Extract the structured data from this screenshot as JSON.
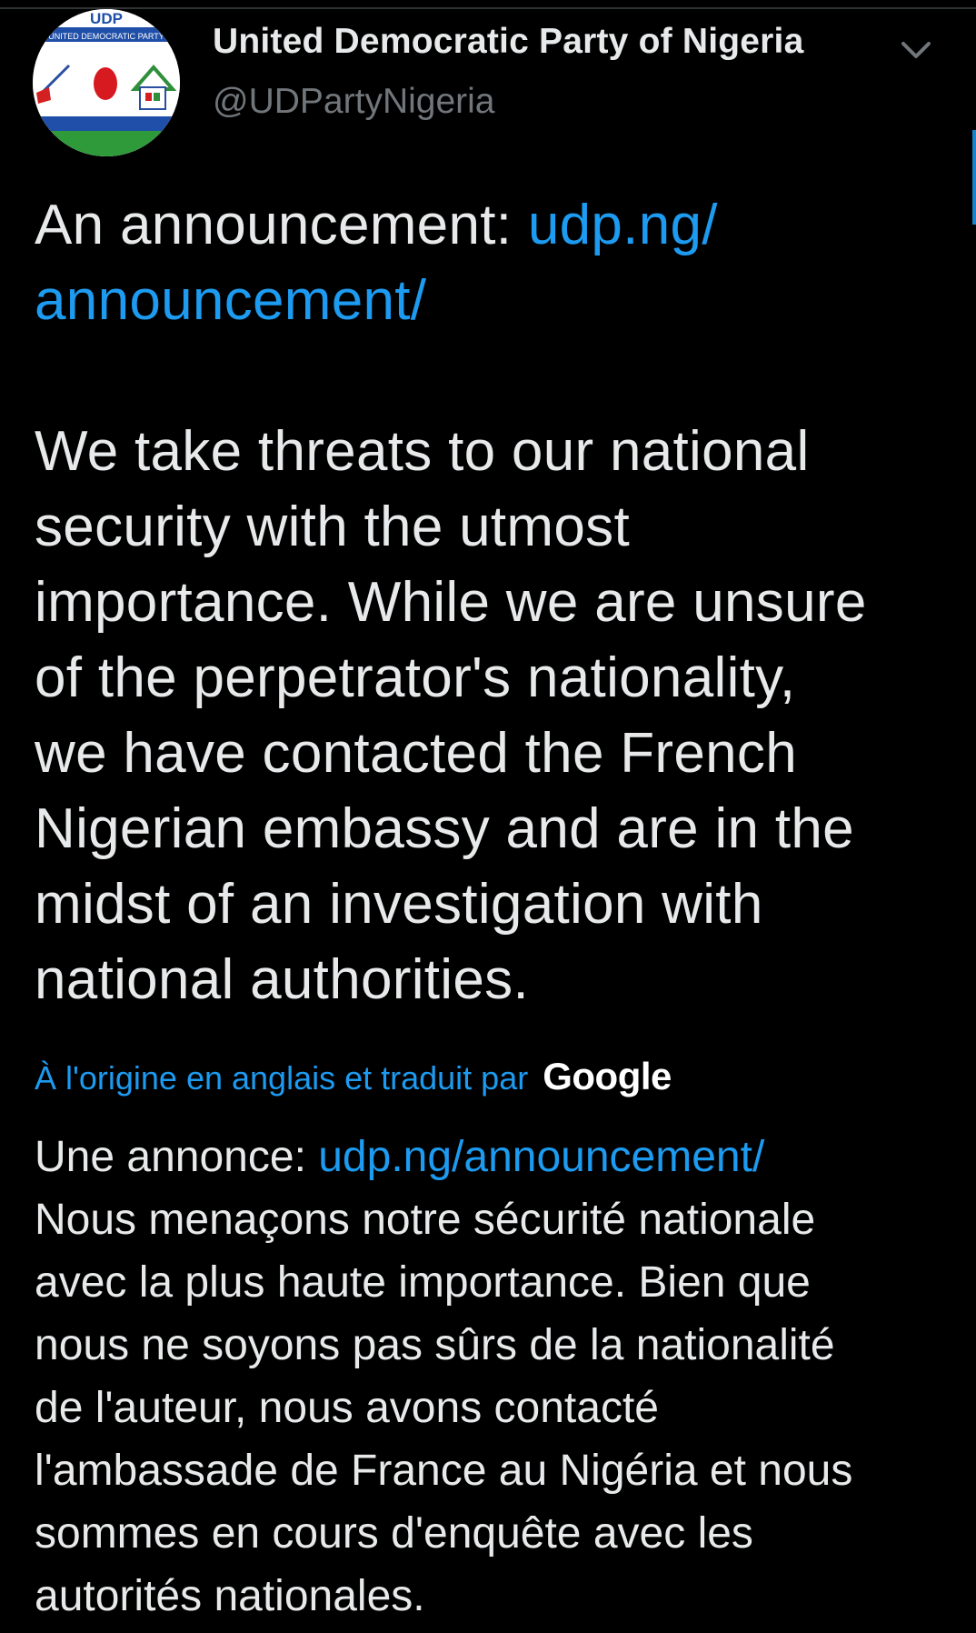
{
  "tweet": {
    "author": {
      "display_name": "United Democratic Party of Nigeria",
      "handle": "@UDPartyNigeria",
      "avatar_text_top": "UDP",
      "avatar_text_sub": "UNITED DEMOCRATIC PARTY"
    },
    "menu_icon": "chevron-down-icon",
    "body": {
      "intro_prefix": "An announcement: ",
      "link_part1": "udp.ng/",
      "link_part2": "announcement/",
      "lines": [
        "We take threats to our national",
        "security with the utmost",
        "importance. While we are unsure",
        "of the perpetrator's nationality,",
        "we have contacted the French",
        "Nigerian embassy and are in the",
        "midst of an investigation with",
        "national authorities."
      ]
    },
    "translation": {
      "attribution": "À l'origine en anglais et traduit par",
      "provider": "Google",
      "intro_prefix": "Une annonce: ",
      "link": "udp.ng/announcement/",
      "lines": [
        "Nous menaçons notre sécurité nationale",
        "avec la plus haute importance. Bien que",
        "nous ne soyons pas sûrs de la nationalité",
        "de l'auteur, nous avons contacté",
        "l'ambassade de France au Nigéria et nous",
        "sommes en cours d'enquête avec les",
        "autorités nationales."
      ]
    }
  },
  "colors": {
    "background": "#000000",
    "text": "#e7e9ea",
    "secondary": "#71767b",
    "link": "#1d9bf0"
  }
}
